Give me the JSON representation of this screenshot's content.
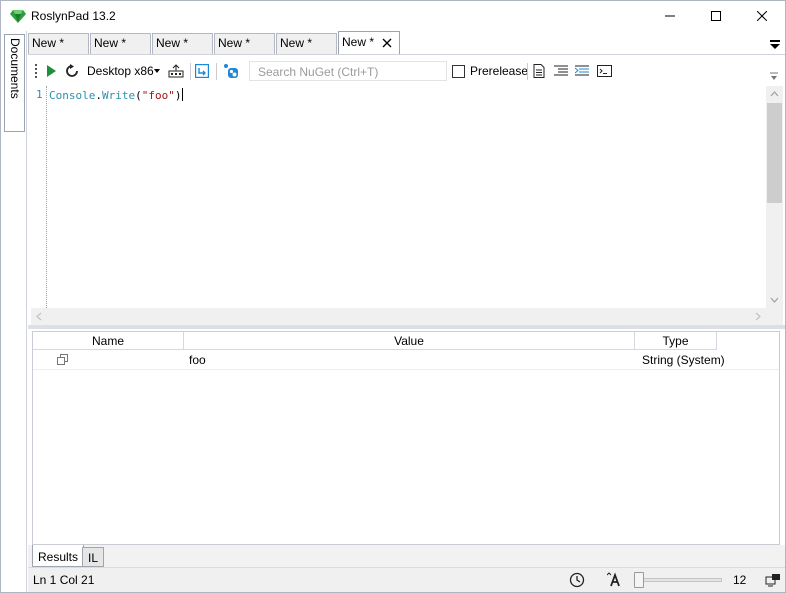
{
  "window": {
    "title": "RoslynPad 13.2"
  },
  "sidebar": {
    "documents_label": "Documents"
  },
  "tabs": [
    {
      "label": "New *"
    },
    {
      "label": "New *"
    },
    {
      "label": "New *"
    },
    {
      "label": "New *"
    },
    {
      "label": "New *"
    },
    {
      "label": "New *",
      "active": true
    }
  ],
  "toolbar": {
    "platform": "Desktop x86",
    "search_placeholder": "Search NuGet (Ctrl+T)",
    "prerelease_label": "Prerelease",
    "prerelease_checked": false
  },
  "editor": {
    "line_number": "1",
    "code": {
      "ident": "Console",
      "dot": ".",
      "method": "Write",
      "open": "(",
      "string": "\"foo\"",
      "close": ")"
    }
  },
  "results": {
    "columns": [
      "Name",
      "Value",
      "Type"
    ],
    "rows": [
      {
        "name": "",
        "value": "foo",
        "type": "String (System)"
      }
    ]
  },
  "bottom_tabs": [
    {
      "label": "Results",
      "active": true
    },
    {
      "label": "IL"
    }
  ],
  "status": {
    "position": "Ln 1 Col 21",
    "zoom": "12"
  },
  "colors": {
    "accent_green": "#1e8e3e",
    "string_red": "#a31515",
    "ident_teal": "#2b91af",
    "nuget_blue": "#1e88d8"
  }
}
